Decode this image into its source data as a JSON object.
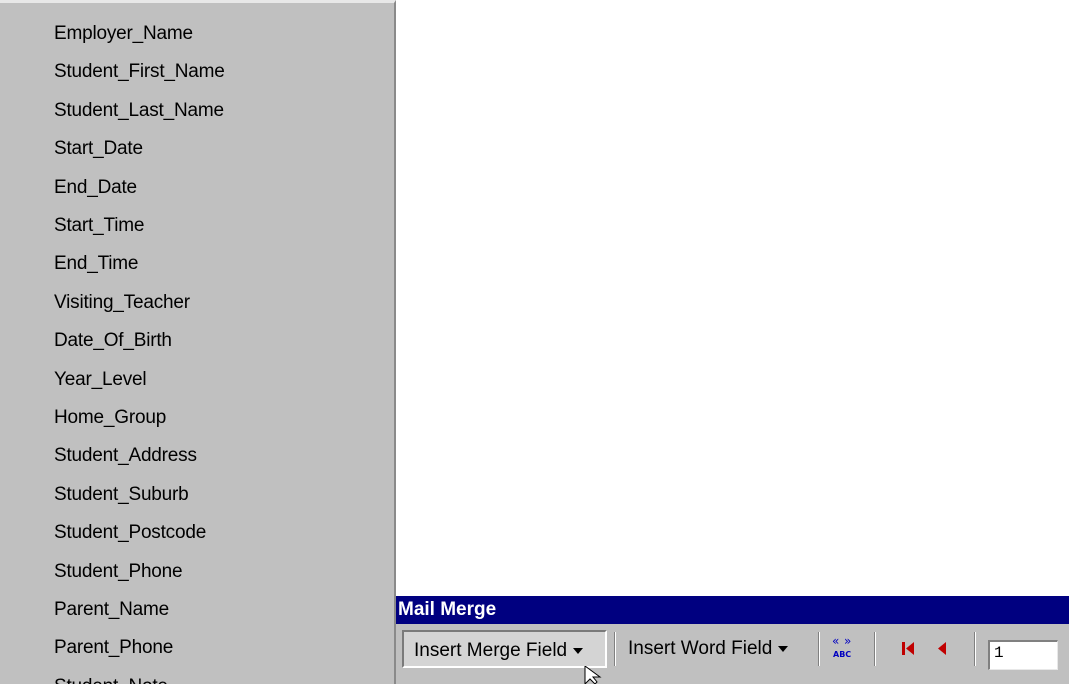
{
  "field_menu": {
    "items": [
      "Employer_Name",
      "Student_First_Name",
      "Student_Last_Name",
      "Start_Date",
      "End_Date",
      "Start_Time",
      "End_Time",
      "Visiting_Teacher",
      "Date_Of_Birth",
      "Year_Level",
      "Home_Group",
      "Student_Address",
      "Student_Suburb",
      "Student_Postcode",
      "Student_Phone",
      "Parent_Name",
      "Parent_Phone",
      "Student_Note"
    ]
  },
  "toolbar": {
    "title": "Mail Merge",
    "insert_merge_field_label": "Insert Merge Field",
    "insert_word_field_label": "Insert Word Field",
    "view_merged_icon": "view-merged-data-icon",
    "first_record_icon": "first-record-icon",
    "previous_record_icon": "previous-record-icon",
    "record_number": "1"
  },
  "colors": {
    "menu_bg": "#c0c0c0",
    "title_bar": "#000080",
    "nav_red": "#c00000",
    "abc_blue": "#0000c0"
  }
}
